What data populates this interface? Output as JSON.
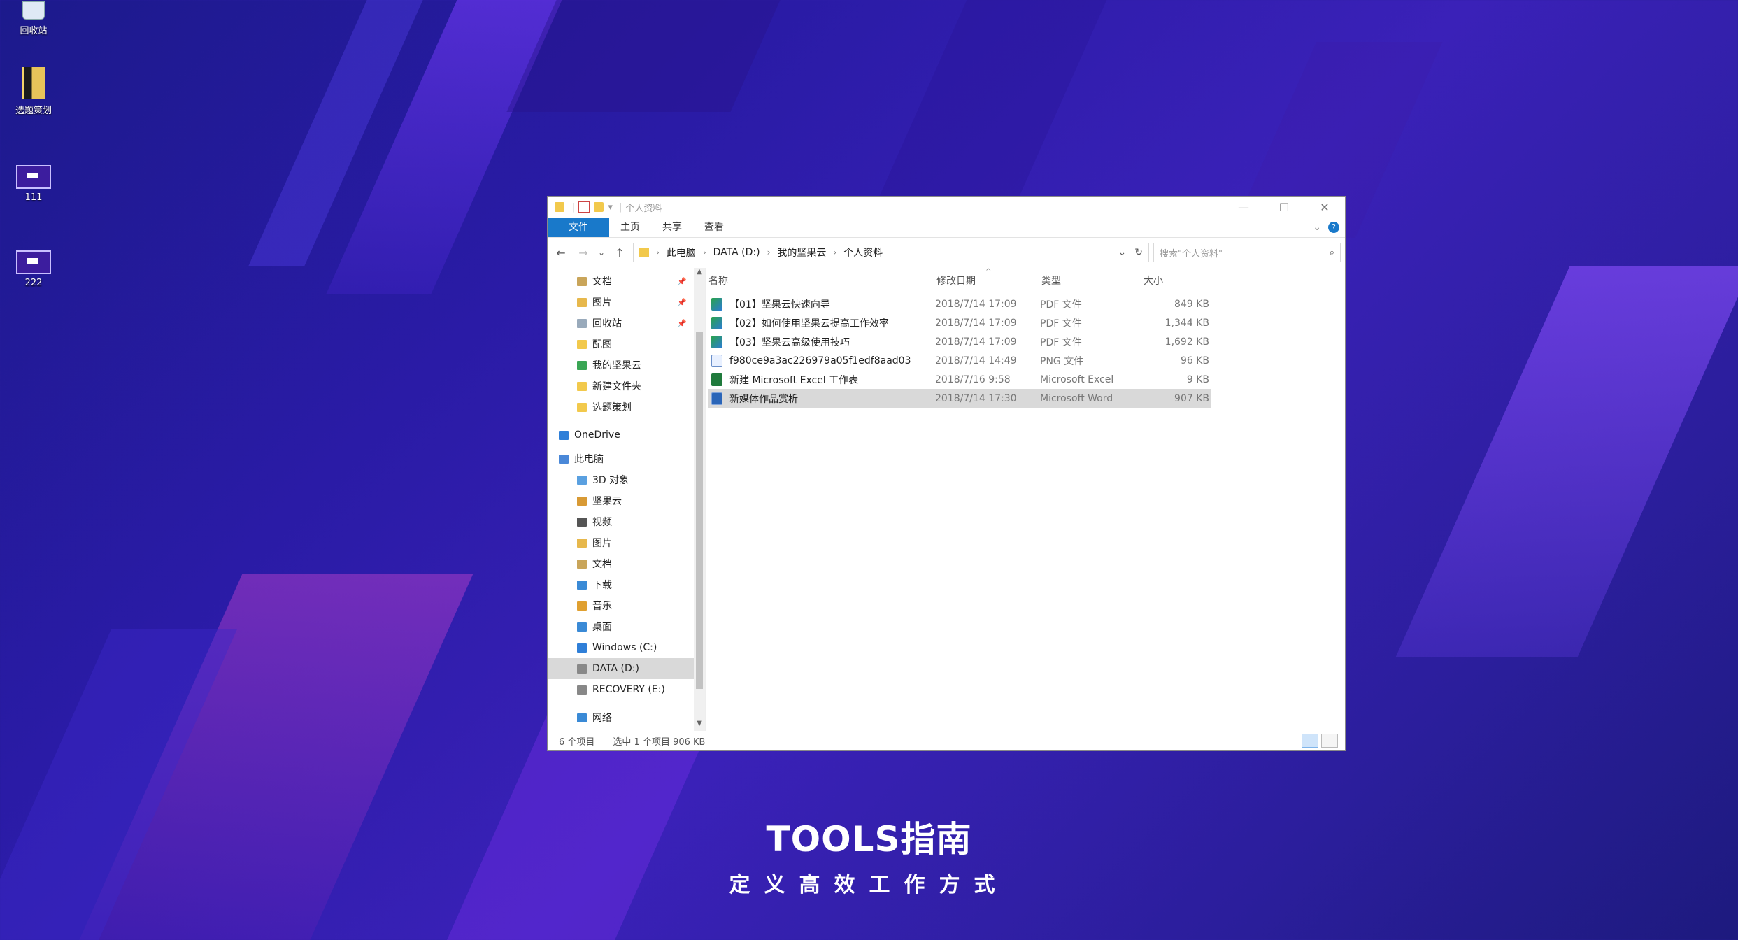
{
  "desktop": {
    "icons": [
      {
        "label": "回收站"
      },
      {
        "label": "选题策划"
      },
      {
        "label": "111"
      },
      {
        "label": "222"
      }
    ]
  },
  "window": {
    "title": "个人资料",
    "controls": {
      "minimize": "—",
      "maximize": "☐",
      "close": "✕"
    },
    "ribbon_tabs": [
      "文件",
      "主页",
      "共享",
      "查看"
    ],
    "help": "?",
    "address": {
      "crumbs": [
        "此电脑",
        "DATA (D:)",
        "我的坚果云",
        "个人资料"
      ]
    },
    "search": {
      "placeholder": "搜索\"个人资料\""
    },
    "nav": [
      {
        "label": "文档",
        "pinned": true
      },
      {
        "label": "图片",
        "pinned": true
      },
      {
        "label": "回收站",
        "pinned": true
      },
      {
        "label": "配图",
        "pinned": false
      },
      {
        "label": "我的坚果云",
        "pinned": false
      },
      {
        "label": "新建文件夹",
        "pinned": false
      },
      {
        "label": "选题策划",
        "pinned": false
      },
      {
        "label": "OneDrive",
        "pinned": false
      },
      {
        "label": "此电脑",
        "pinned": false
      },
      {
        "label": "3D 对象",
        "pinned": false
      },
      {
        "label": "坚果云",
        "pinned": false
      },
      {
        "label": "视频",
        "pinned": false
      },
      {
        "label": "图片",
        "pinned": false
      },
      {
        "label": "文档",
        "pinned": false
      },
      {
        "label": "下载",
        "pinned": false
      },
      {
        "label": "音乐",
        "pinned": false
      },
      {
        "label": "桌面",
        "pinned": false
      },
      {
        "label": "Windows (C:)",
        "pinned": false
      },
      {
        "label": "DATA (D:)",
        "pinned": false
      },
      {
        "label": "RECOVERY (E:)",
        "pinned": false
      },
      {
        "label": "网络",
        "pinned": false
      }
    ],
    "columns": [
      "名称",
      "修改日期",
      "类型",
      "大小"
    ],
    "files": [
      {
        "name": "【01】坚果云快速向导",
        "date": "2018/7/14 17:09",
        "type": "PDF 文件",
        "size": "849 KB"
      },
      {
        "name": "【02】如何使用坚果云提高工作效率",
        "date": "2018/7/14 17:09",
        "type": "PDF 文件",
        "size": "1,344 KB"
      },
      {
        "name": "【03】坚果云高级使用技巧",
        "date": "2018/7/14 17:09",
        "type": "PDF 文件",
        "size": "1,692 KB"
      },
      {
        "name": "f980ce9a3ac226979a05f1edf8aad03",
        "date": "2018/7/14 14:49",
        "type": "PNG 文件",
        "size": "96 KB"
      },
      {
        "name": "新建 Microsoft Excel 工作表",
        "date": "2018/7/16 9:58",
        "type": "Microsoft Excel",
        "size": "9 KB"
      },
      {
        "name": "新媒体作品赏析",
        "date": "2018/7/14 17:30",
        "type": "Microsoft Word",
        "size": "907 KB"
      }
    ],
    "status": {
      "count": "6 个项目",
      "selection": "选中 1 个项目  906 KB"
    }
  },
  "brand": {
    "title": "TOOLS指南",
    "subtitle": "定义高效工作方式"
  }
}
